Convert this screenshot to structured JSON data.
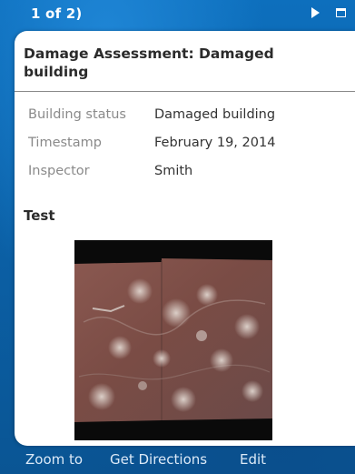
{
  "window": {
    "title": "1 of 2)",
    "controls": [
      "next-icon",
      "maximize-icon"
    ]
  },
  "popup": {
    "title": "Damage Assessment: Damaged building",
    "fields": [
      {
        "label": "Building status",
        "value": "Damaged building"
      },
      {
        "label": "Timestamp",
        "value": "February 19, 2014"
      },
      {
        "label": "Inspector",
        "value": "Smith"
      }
    ],
    "attachment_title": "Test",
    "image_icon": "aerial-photo-thumbnail"
  },
  "actions": {
    "zoom_to": "Zoom to",
    "get_directions": "Get Directions",
    "edit": "Edit"
  },
  "colors": {
    "frame": "#0b63a8",
    "label": "#8a8a8a",
    "link": "#dbe9f7"
  }
}
